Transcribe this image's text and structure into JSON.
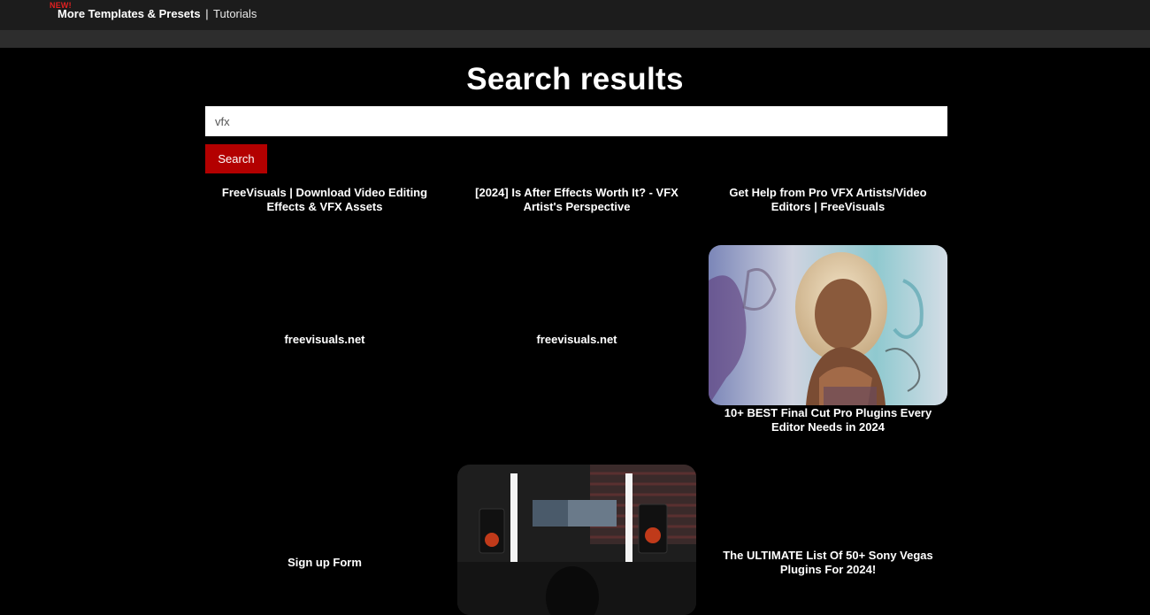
{
  "header": {
    "badge": "NEW!",
    "nav_primary": "More Templates & Presets",
    "separator": "|",
    "nav_secondary": "Tutorials"
  },
  "main": {
    "title": "Search results",
    "search": {
      "value": "vfx",
      "button_label": "Search"
    },
    "results": [
      {
        "title": "FreeVisuals | Download Video Editing Effects & VFX Assets"
      },
      {
        "title": "[2024] Is After Effects Worth It? - VFX Artist's Perspective"
      },
      {
        "title": "Get Help from Pro VFX Artists/Video Editors | FreeVisuals"
      },
      {
        "title": "freevisuals.net"
      },
      {
        "title": "freevisuals.net"
      },
      {
        "title": "10+ BEST Final Cut Pro Plugins Every Editor Needs in 2024",
        "thumbnail": "woman-portrait-graffiti-wall"
      },
      {
        "title": "Sign up Form"
      },
      {
        "title": "",
        "thumbnail": "video-editing-desk-setup"
      },
      {
        "title": "The ULTIMATE List Of 50+ Sony Vegas Plugins For 2024!"
      }
    ]
  },
  "colors": {
    "topbar": "#1c1c1c",
    "subbar": "#2d2d2d",
    "accent_red": "#b30000",
    "badge_red": "#e02020",
    "background": "#000000"
  }
}
